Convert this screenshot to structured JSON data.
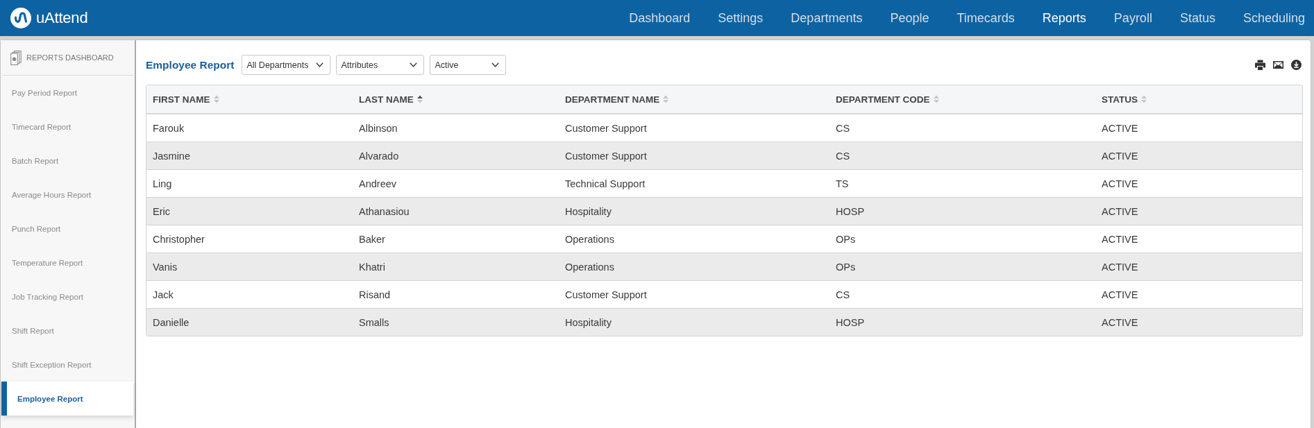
{
  "header": {
    "logo_text": "uAttend",
    "nav": [
      {
        "label": "Dashboard",
        "selected": false
      },
      {
        "label": "Settings",
        "selected": false
      },
      {
        "label": "Departments",
        "selected": false
      },
      {
        "label": "People",
        "selected": false
      },
      {
        "label": "Timecards",
        "selected": false
      },
      {
        "label": "Reports",
        "selected": true
      },
      {
        "label": "Payroll",
        "selected": false
      },
      {
        "label": "Status",
        "selected": false
      },
      {
        "label": "Scheduling",
        "selected": false
      }
    ]
  },
  "sidebar": {
    "title": "REPORTS DASHBOARD",
    "items": [
      {
        "label": "Pay Period Report",
        "selected": false
      },
      {
        "label": "Timecard Report",
        "selected": false
      },
      {
        "label": "Batch Report",
        "selected": false
      },
      {
        "label": "Average Hours Report",
        "selected": false
      },
      {
        "label": "Punch Report",
        "selected": false
      },
      {
        "label": "Temperature Report",
        "selected": false
      },
      {
        "label": "Job Tracking Report",
        "selected": false
      },
      {
        "label": "Shift Report",
        "selected": false
      },
      {
        "label": "Shift Exception Report",
        "selected": false
      },
      {
        "label": "Employee Report",
        "selected": true
      }
    ]
  },
  "report": {
    "title": "Employee Report",
    "filters": [
      "All Departments",
      "Attributes",
      "Active"
    ],
    "table": {
      "columns": [
        {
          "label": "FIRST NAME",
          "sorted": false
        },
        {
          "label": "LAST NAME",
          "sorted": true
        },
        {
          "label": "DEPARTMENT NAME",
          "sorted": false
        },
        {
          "label": "DEPARTMENT CODE",
          "sorted": false
        },
        {
          "label": "STATUS",
          "sorted": false
        }
      ],
      "rows": [
        [
          "Farouk",
          "Albinson",
          "Customer Support",
          "CS",
          "ACTIVE"
        ],
        [
          "Jasmine",
          "Alvarado",
          "Customer Support",
          "CS",
          "ACTIVE"
        ],
        [
          "Ling",
          "Andreev",
          "Technical Support",
          "TS",
          "ACTIVE"
        ],
        [
          "Eric",
          "Athanasiou",
          "Hospitality",
          "HOSP",
          "ACTIVE"
        ],
        [
          "Christopher",
          "Baker",
          "Operations",
          "OPs",
          "ACTIVE"
        ],
        [
          "Vanis",
          "Khatri",
          "Operations",
          "OPs",
          "ACTIVE"
        ],
        [
          "Jack",
          "Risand",
          "Customer Support",
          "CS",
          "ACTIVE"
        ],
        [
          "Danielle",
          "Smalls",
          "Hospitality",
          "HOSP",
          "ACTIVE"
        ]
      ]
    }
  }
}
